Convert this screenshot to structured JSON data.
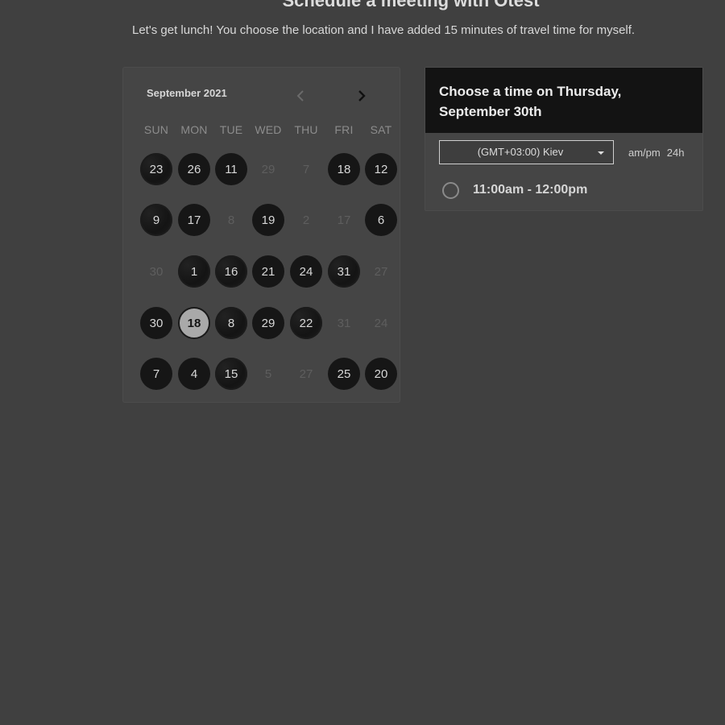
{
  "header": {
    "title": "Schedule a meeting with Otest",
    "subtitle": "Let's get lunch! You choose the location and I have added 15 minutes of travel time for myself."
  },
  "calendar": {
    "month_label": "September 2021",
    "weekdays": [
      "SUN",
      "MON",
      "TUE",
      "WED",
      "THU",
      "FRI",
      "SAT"
    ],
    "weeks": [
      [
        {
          "label": "23",
          "state": "available",
          "speckled": true
        },
        {
          "label": "26",
          "state": "available"
        },
        {
          "label": "11",
          "state": "available"
        },
        {
          "label": "29",
          "state": "unavailable"
        },
        {
          "label": "7",
          "state": "unavailable"
        },
        {
          "label": "18",
          "state": "available"
        },
        {
          "label": "12",
          "state": "available"
        }
      ],
      [
        {
          "label": "9",
          "state": "available",
          "speckled": true
        },
        {
          "label": "17",
          "state": "available"
        },
        {
          "label": "8",
          "state": "unavailable"
        },
        {
          "label": "19",
          "state": "available"
        },
        {
          "label": "2",
          "state": "unavailable"
        },
        {
          "label": "17",
          "state": "unavailable"
        },
        {
          "label": "6",
          "state": "available"
        }
      ],
      [
        {
          "label": "30",
          "state": "unavailable"
        },
        {
          "label": "1",
          "state": "available",
          "speckled": true
        },
        {
          "label": "16",
          "state": "available",
          "speckled": true
        },
        {
          "label": "21",
          "state": "available"
        },
        {
          "label": "24",
          "state": "available"
        },
        {
          "label": "31",
          "state": "available",
          "speckled": true
        },
        {
          "label": "27",
          "state": "unavailable"
        }
      ],
      [
        {
          "label": "30",
          "state": "available"
        },
        {
          "label": "18",
          "state": "selected"
        },
        {
          "label": "8",
          "state": "available",
          "speckled": true
        },
        {
          "label": "29",
          "state": "available"
        },
        {
          "label": "22",
          "state": "available",
          "speckled": true
        },
        {
          "label": "31",
          "state": "unavailable"
        },
        {
          "label": "24",
          "state": "unavailable"
        }
      ],
      [
        {
          "label": "7",
          "state": "available"
        },
        {
          "label": "4",
          "state": "available"
        },
        {
          "label": "15",
          "state": "available",
          "speckled": true
        },
        {
          "label": "5",
          "state": "unavailable"
        },
        {
          "label": "27",
          "state": "unavailable"
        },
        {
          "label": "25",
          "state": "available"
        },
        {
          "label": "20",
          "state": "available"
        }
      ]
    ],
    "icons": {
      "prev": "chevron-left-icon",
      "next": "chevron-right-icon"
    }
  },
  "time_panel": {
    "title": "Choose a time on Thursday, September 30th",
    "timezone_value": "(GMT+03:00) Kiev",
    "format_ampm": "am/pm",
    "format_24h": "24h",
    "slots": [
      {
        "label": "11:00am - 12:00pm"
      }
    ]
  },
  "colors": {
    "background": "#404040",
    "available_day": "#161616",
    "selected_day": "#a9a9a9",
    "header_dark": "#131313"
  }
}
